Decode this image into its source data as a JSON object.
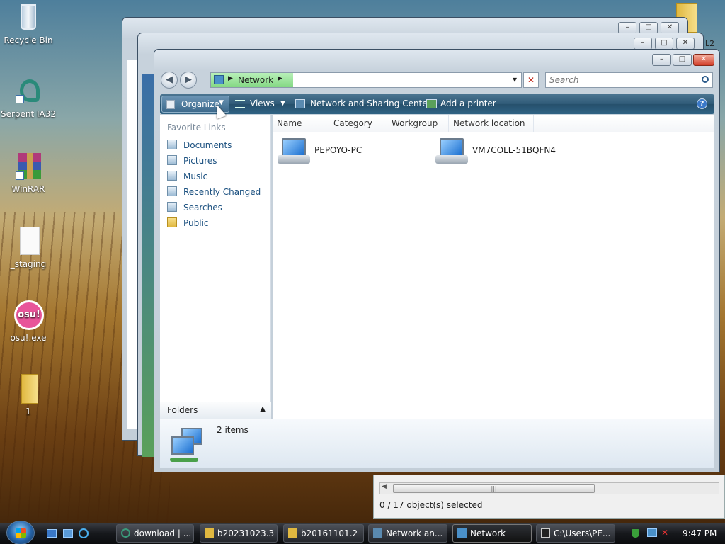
{
  "desktop_icons": [
    {
      "label": "Recycle Bin",
      "icon": "recycle-bin-icon"
    },
    {
      "label": "Serpent IA32",
      "icon": "serpent-shortcut-icon"
    },
    {
      "label": "WinRAR",
      "icon": "winrar-icon"
    },
    {
      "label": "_staging",
      "icon": "file-icon"
    },
    {
      "label": "osu!.exe",
      "icon": "osu-icon"
    },
    {
      "label": "1",
      "icon": "folder-icon"
    }
  ],
  "osu_text": "osu!",
  "window": {
    "title_buttons": {
      "minimize": "–",
      "maximize": "□",
      "close": "✕"
    },
    "address": {
      "arrow": "▶",
      "location": "Network",
      "separator": "▶",
      "dropdown": "▾",
      "stop": "✕"
    },
    "search": {
      "placeholder": "Search",
      "icon": "search-icon"
    },
    "toolbar": {
      "organize": "Organize",
      "views": "Views",
      "network_center": "Network and Sharing Center",
      "add_printer": "Add a printer",
      "help": "?"
    },
    "favorite_links": {
      "title": "Favorite Links",
      "items": [
        "Documents",
        "Pictures",
        "Music",
        "Recently Changed",
        "Searches",
        "Public"
      ]
    },
    "folders_label": "Folders",
    "columns": [
      "Name",
      "Category",
      "Workgroup",
      "Network location"
    ],
    "items": [
      "PEPOYO-PC",
      "VM7COLL-51BQFN4"
    ],
    "details": {
      "count": "2 items"
    }
  },
  "background_window": {
    "status": "0 / 17 object(s) selected",
    "scroll_grip": "|||",
    "edge_text": "L2"
  },
  "taskbar": {
    "buttons": [
      "download | ...",
      "b20231023.3",
      "b20161101.2",
      "Network an...",
      "Network",
      "C:\\Users\\PE..."
    ],
    "active": "Network",
    "clock": "9:47 PM"
  },
  "colors": {
    "toolbar": "#2f5a77",
    "link": "#1c5180",
    "accent": "#1b6fd0"
  }
}
